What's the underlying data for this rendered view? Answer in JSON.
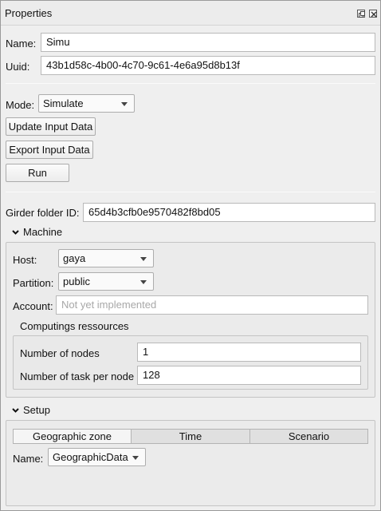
{
  "window": {
    "title": "Properties"
  },
  "name": {
    "label": "Name:",
    "value": "Simu"
  },
  "uuid": {
    "label": "Uuid:",
    "value": "43b1d58c-4b00-4c70-9c61-4e6a95d8b13f"
  },
  "mode": {
    "label": "Mode:",
    "value": "Simulate"
  },
  "buttons": {
    "update": "Update Input Data",
    "export": "Export Input Data",
    "run": "Run"
  },
  "girder": {
    "label": "Girder folder ID:",
    "value": "65d4b3cfb0e9570482f8bd05"
  },
  "machine": {
    "title": "Machine",
    "host_label": "Host:",
    "host_value": "gaya",
    "partition_label": "Partition:",
    "partition_value": "public",
    "account_label": "Account:",
    "account_placeholder": "Not yet implemented",
    "resources_title": "Computings ressources",
    "nodes_label": "Number of nodes",
    "nodes_value": "1",
    "tasks_label": "Number of task per node",
    "tasks_value": "128"
  },
  "setup": {
    "title": "Setup",
    "tabs": [
      "Geographic zone",
      "Time",
      "Scenario"
    ],
    "name_label": "Name:",
    "name_value": "GeographicData"
  }
}
